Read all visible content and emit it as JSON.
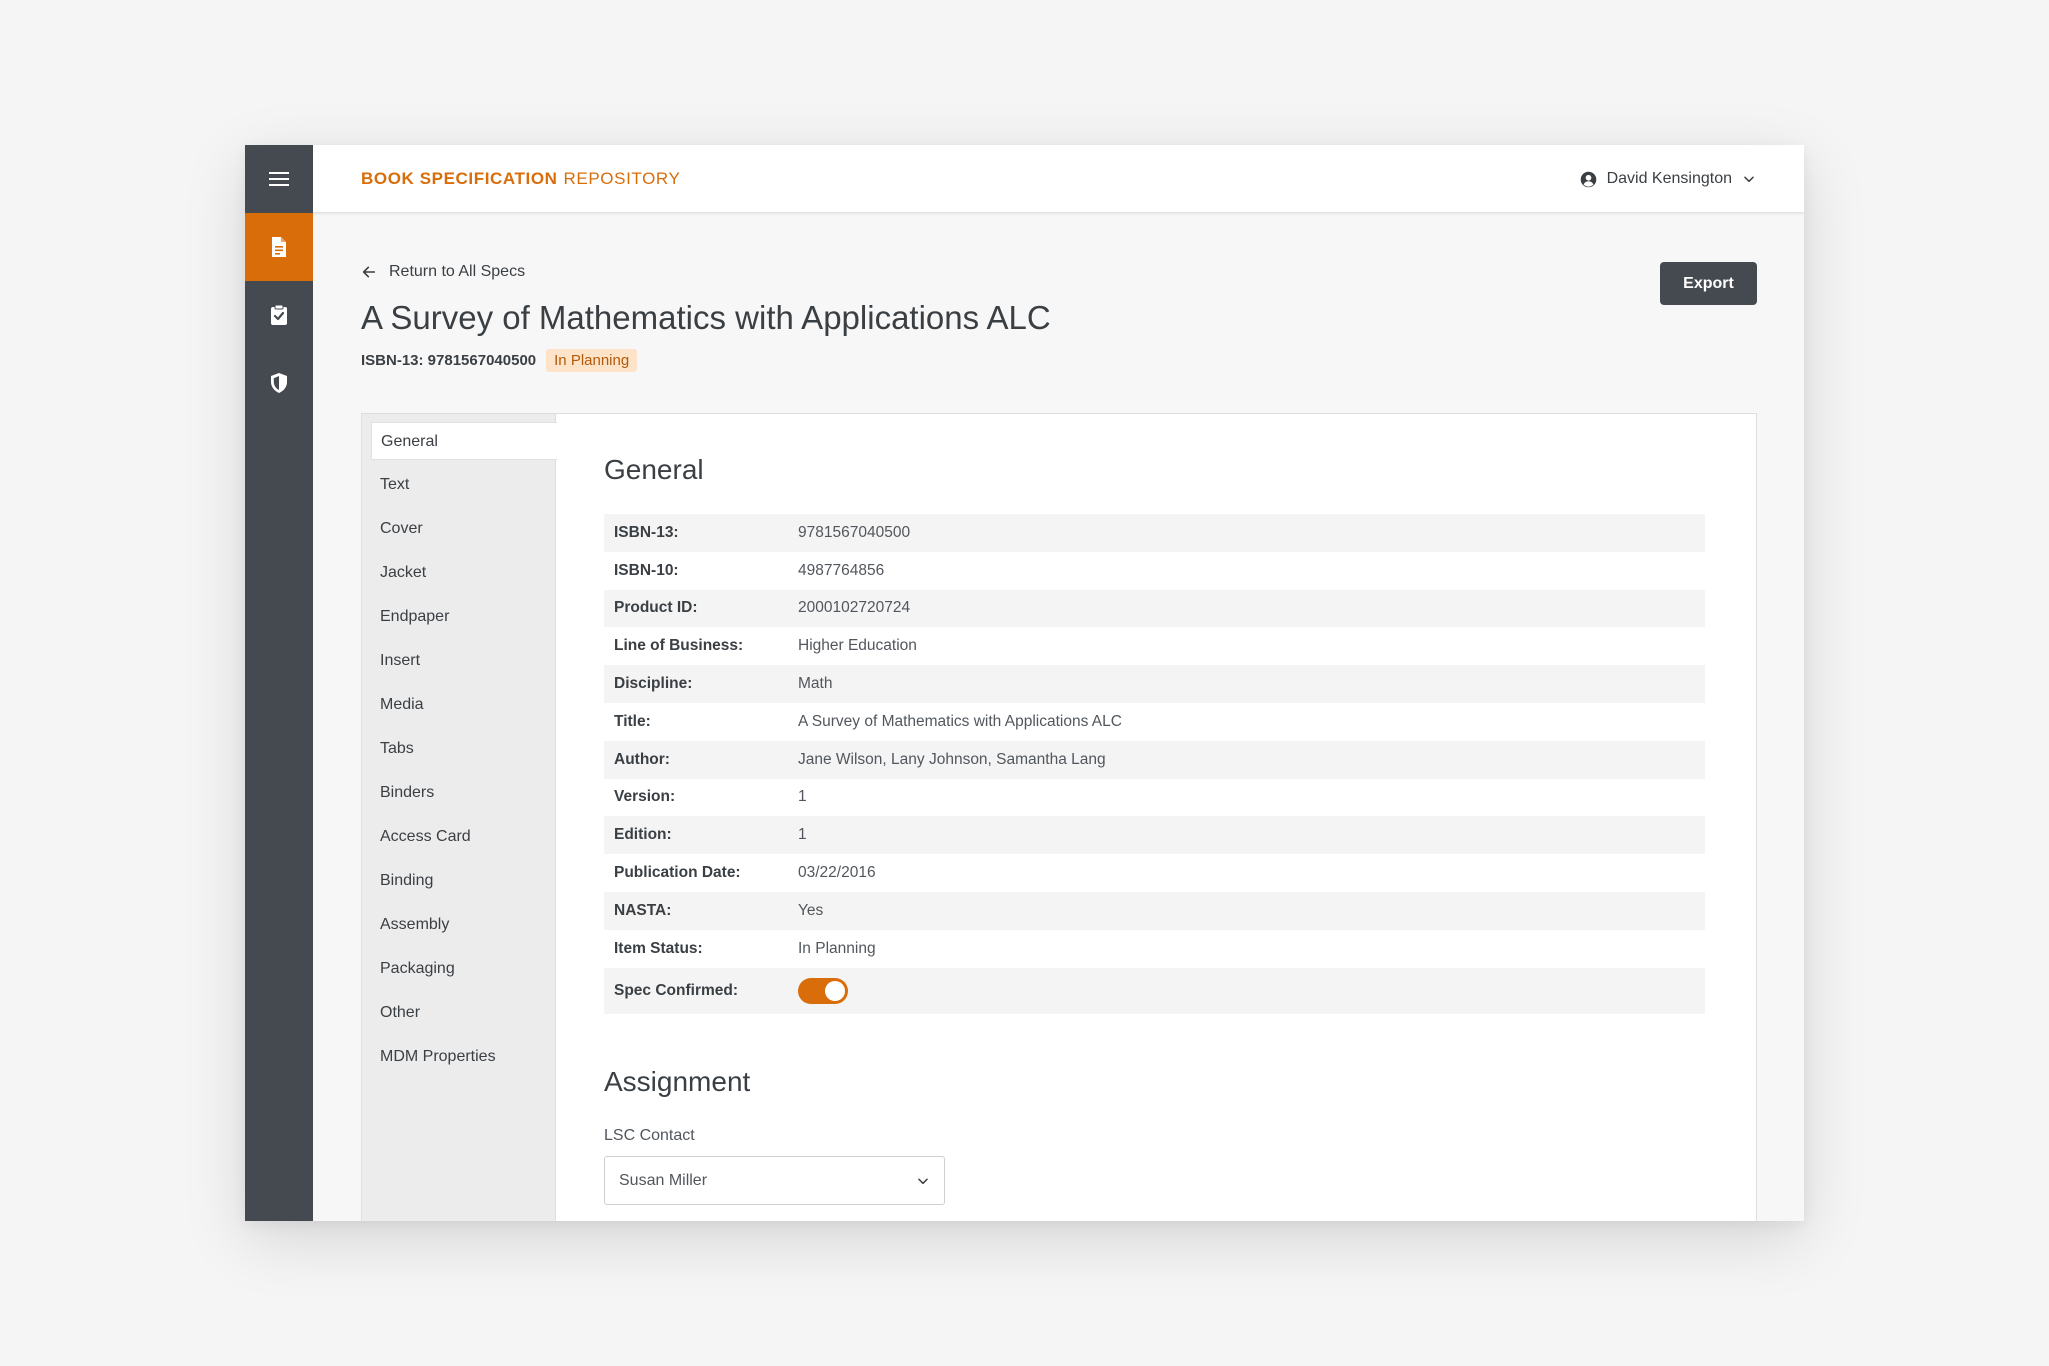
{
  "app": {
    "brand_bold": "BOOK SPECIFICATION",
    "brand_light": "REPOSITORY",
    "user_name": "David Kensington",
    "accent_color": "#d96d0a"
  },
  "rail": {
    "items": [
      {
        "name": "menu-icon",
        "active": false
      },
      {
        "name": "document-icon",
        "active": true
      },
      {
        "name": "clipboard-check-icon",
        "active": false
      },
      {
        "name": "shield-icon",
        "active": false
      }
    ]
  },
  "page": {
    "back_label": "Return to All Specs",
    "title": "A Survey of Mathematics with Applications ALC",
    "isbn_meta": "ISBN-13: 9781567040500",
    "status_badge": "In Planning",
    "export_label": "Export"
  },
  "tabs": [
    "General",
    "Text",
    "Cover",
    "Jacket",
    "Endpaper",
    "Insert",
    "Media",
    "Tabs",
    "Binders",
    "Access Card",
    "Binding",
    "Assembly",
    "Packaging",
    "Other",
    "MDM Properties"
  ],
  "active_tab": "General",
  "general": {
    "title": "General",
    "rows": [
      {
        "label": "ISBN-13:",
        "value": "9781567040500"
      },
      {
        "label": "ISBN-10:",
        "value": "4987764856"
      },
      {
        "label": "Product ID:",
        "value": "2000102720724"
      },
      {
        "label": "Line of Business:",
        "value": "Higher Education"
      },
      {
        "label": "Discipline:",
        "value": "Math"
      },
      {
        "label": "Title:",
        "value": "A Survey of Mathematics with Applications ALC"
      },
      {
        "label": "Author:",
        "value": "Jane Wilson, Lany Johnson, Samantha Lang"
      },
      {
        "label": "Version:",
        "value": "1"
      },
      {
        "label": "Edition:",
        "value": "1"
      },
      {
        "label": "Publication Date:",
        "value": "03/22/2016"
      },
      {
        "label": "NASTA:",
        "value": "Yes"
      },
      {
        "label": "Item Status:",
        "value": "In Planning"
      }
    ],
    "spec_confirmed_label": "Spec Confirmed:",
    "spec_confirmed": true
  },
  "assignment": {
    "title": "Assignment",
    "lsc_contact_label": "LSC Contact",
    "lsc_contact_value": "Susan Miller"
  }
}
